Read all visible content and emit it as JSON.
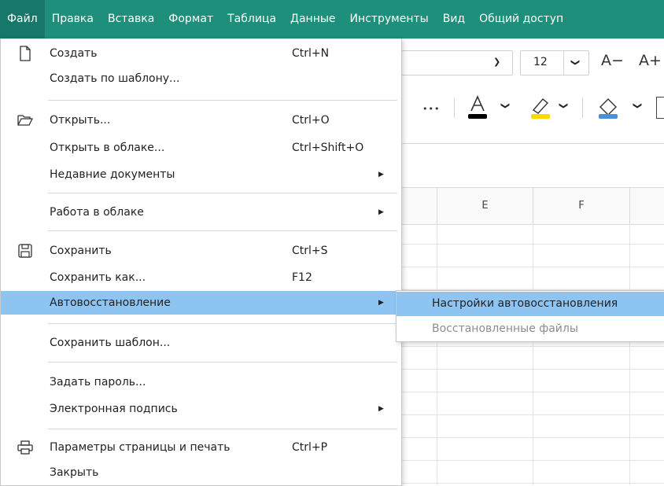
{
  "menubar": {
    "items": [
      "Файл",
      "Правка",
      "Вставка",
      "Формат",
      "Таблица",
      "Данные",
      "Инструменты",
      "Вид",
      "Общий доступ"
    ]
  },
  "toolbar": {
    "font_size": "12",
    "increase_font": "A+",
    "decrease_font": "A−",
    "more": "•••"
  },
  "sheet": {
    "columns": [
      "E",
      "F"
    ]
  },
  "file_menu": {
    "items": [
      {
        "label": "Создать",
        "shortcut": "Ctrl+N",
        "icon": "new-document-icon"
      },
      {
        "label": "Создать по шаблону...",
        "shortcut": ""
      },
      {
        "label": "Открыть...",
        "shortcut": "Ctrl+O",
        "icon": "folder-open-icon"
      },
      {
        "label": "Открыть в облаке...",
        "shortcut": "Ctrl+Shift+O"
      },
      {
        "label": "Недавние документы",
        "shortcut": "",
        "submenu": true
      },
      {
        "label": "Работа в облаке",
        "shortcut": "",
        "submenu": true
      },
      {
        "label": "Сохранить",
        "shortcut": "Ctrl+S",
        "icon": "save-icon"
      },
      {
        "label": "Сохранить как...",
        "shortcut": "F12"
      },
      {
        "label": "Автовосстановление",
        "shortcut": "",
        "submenu": true,
        "highlighted": true
      },
      {
        "label": "Сохранить шаблон...",
        "shortcut": ""
      },
      {
        "label": "Задать пароль...",
        "shortcut": ""
      },
      {
        "label": "Электронная подпись",
        "shortcut": "",
        "submenu": true
      },
      {
        "label": "Параметры страницы и печать",
        "shortcut": "Ctrl+P",
        "icon": "print-icon"
      },
      {
        "label": "Закрыть",
        "shortcut": ""
      }
    ]
  },
  "autorecovery_submenu": {
    "items": [
      {
        "label": "Настройки автовосстановления",
        "highlighted": true,
        "disabled": false
      },
      {
        "label": "Восстановленные файлы",
        "highlighted": false,
        "disabled": true
      }
    ]
  },
  "colors": {
    "menubar_bg": "#1e8f7a",
    "highlight": "#8ec4f2"
  }
}
